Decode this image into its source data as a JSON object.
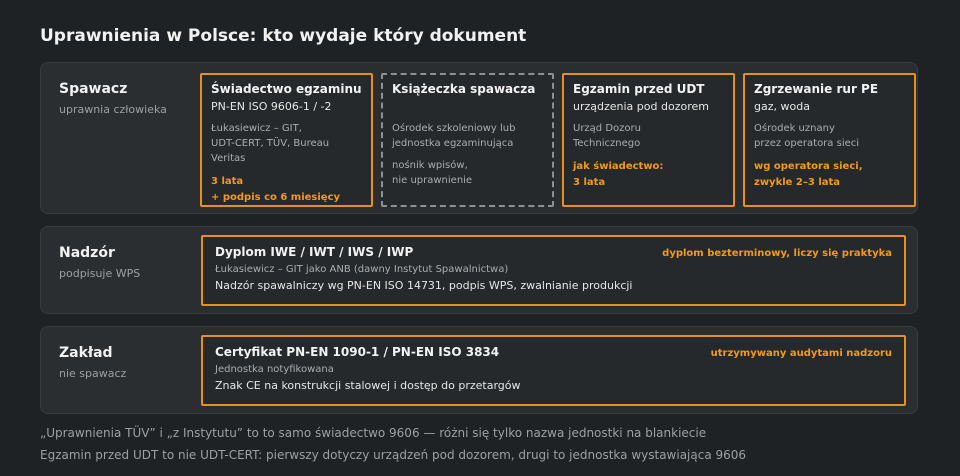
{
  "title": "Uprawnienia w Polsce: kto wydaje który dokument",
  "colors": {
    "background": "#1f2224",
    "panel": "#2a2e31",
    "accent": "#e8901e",
    "accent_text": "#f39a1e",
    "dashed_border": "#8c9194"
  },
  "welder": {
    "name": "Spawacz",
    "sub": "uprawnia człowieka",
    "cards": [
      {
        "title": "Świadectwo egzaminu",
        "sub": "PN-EN ISO 9606-1 / -2",
        "issuer": "Łukasiewicz – GIT,\nUDT-CERT, TÜV, Bureau Veritas",
        "validity": "3 lata\n+ podpis co 6 miesięcy"
      },
      {
        "title": "Książeczka spawacza",
        "issuer": "Ośrodek szkoleniowy lub\njednostka egzaminująca",
        "note": "nośnik wpisów,\nnie uprawnienie"
      },
      {
        "title": "Egzamin przed UDT",
        "sub": "urządzenia pod dozorem",
        "issuer": "Urząd Dozoru\nTechnicznego",
        "validity": "jak świadectwo:\n3 lata"
      },
      {
        "title": "Zgrzewanie rur PE",
        "sub": "gaz, woda",
        "issuer": "Ośrodek uznany\nprzez operatora sieci",
        "validity": "wg operatora sieci,\nzwykle 2–3 lata"
      }
    ]
  },
  "supervision": {
    "name": "Nadzór",
    "sub": "podpisuje WPS",
    "card": {
      "title": "Dyplom IWE / IWT / IWS / IWP",
      "tag": "dyplom bezterminowy, liczy się praktyka",
      "issuer": "Łukasiewicz – GIT jako ANB (dawny Instytut Spawalnictwa)",
      "desc": "Nadzór spawalniczy wg PN-EN ISO 14731, podpis WPS, zwalnianie produkcji"
    }
  },
  "plant": {
    "name": "Zakład",
    "sub": "nie spawacz",
    "card": {
      "title": "Certyfikat PN-EN 1090-1 / PN-EN ISO 3834",
      "tag": "utrzymywany audytami nadzoru",
      "issuer": "Jednostka notyfikowana",
      "desc": "Znak CE na konstrukcji stalowej i dostęp do przetargów"
    }
  },
  "footnotes": [
    "„Uprawnienia TÜV” i „z Instytutu” to to samo świadectwo 9606 — różni się tylko nazwa jednostki na blankiecie",
    "Egzamin przed UDT to nie UDT-CERT: pierwszy dotyczy urządzeń pod dozorem, drugi to jednostka wystawiająca 9606"
  ]
}
